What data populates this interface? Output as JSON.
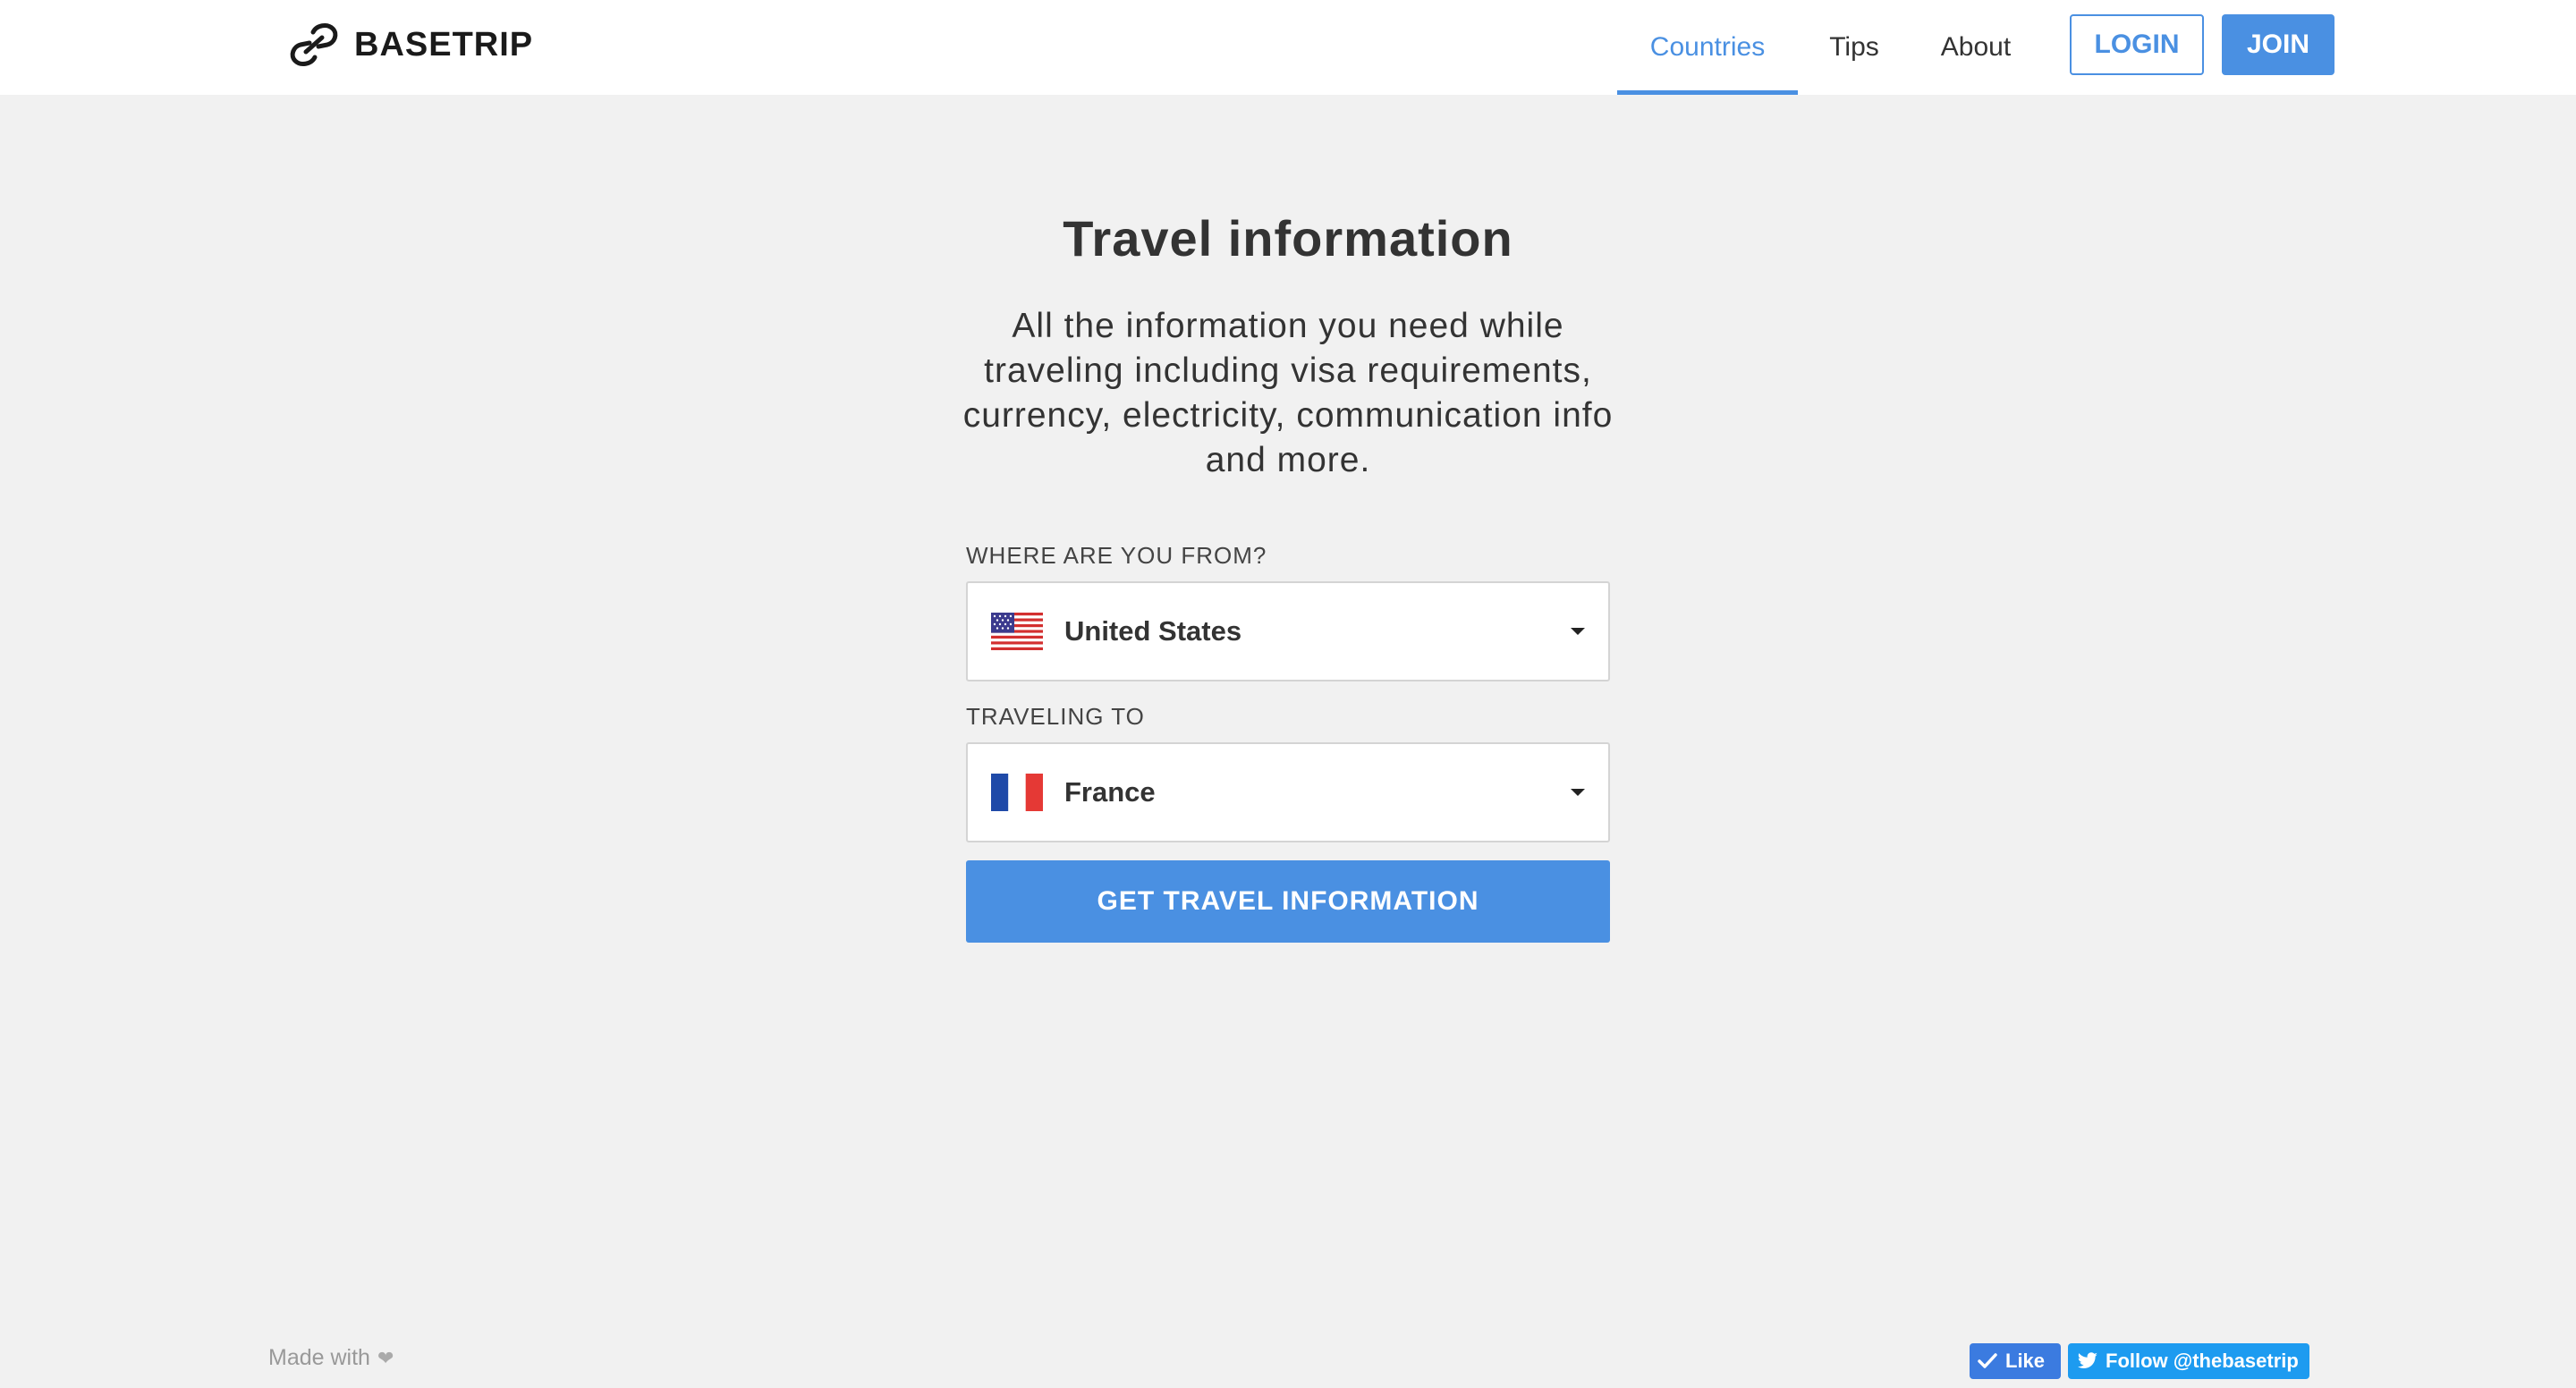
{
  "brand": {
    "name": "BASETRIP"
  },
  "nav": {
    "items": [
      {
        "label": "Countries",
        "active": true
      },
      {
        "label": "Tips",
        "active": false
      },
      {
        "label": "About",
        "active": false
      }
    ],
    "login_label": "LOGIN",
    "join_label": "JOIN"
  },
  "main": {
    "title": "Travel information",
    "subtitle": "All the information you need while traveling including visa requirements, currency, electricity, communication info and more.",
    "from": {
      "label": "WHERE ARE YOU FROM?",
      "value": "United States",
      "flag_icon": "us-flag-icon"
    },
    "to": {
      "label": "TRAVELING TO",
      "value": "France",
      "flag_icon": "fr-flag-icon"
    },
    "submit_label": "GET TRAVEL INFORMATION"
  },
  "footer": {
    "made_with": "Made with",
    "heart_icon": "heart-icon",
    "like_label": "Like",
    "follow_label": "Follow @thebasetrip"
  },
  "colors": {
    "accent": "#4a90e2",
    "background": "#f1f1f1",
    "header": "#ffffff",
    "text": "#333333"
  }
}
